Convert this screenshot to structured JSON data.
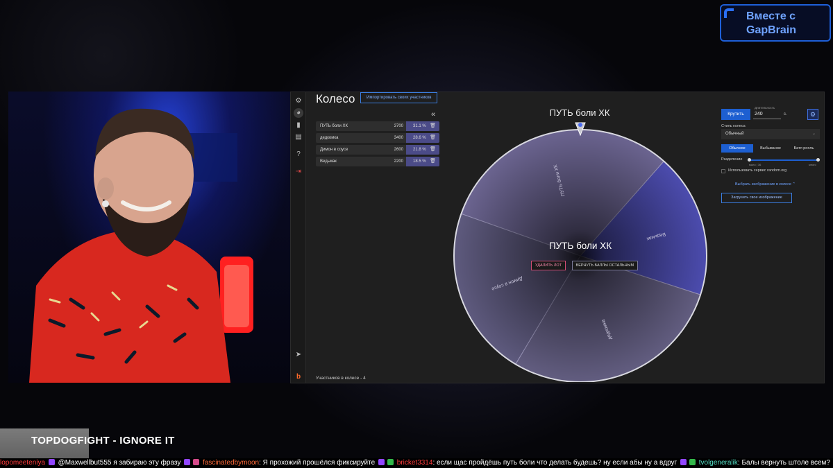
{
  "brand": {
    "line1": "Вместе с",
    "line2": "GapBrain"
  },
  "app": {
    "title": "Колесо",
    "import_button": "Импортировать своих участников",
    "collapse_glyph": "«",
    "participants": [
      {
        "name": "ПУТЬ боли ХК",
        "amount": "3700",
        "percent": "31.1 %"
      },
      {
        "name": "дедкомка",
        "amount": "3400",
        "percent": "28.6 %"
      },
      {
        "name": "Димон в соусе",
        "amount": "2600",
        "percent": "21.8 %"
      },
      {
        "name": "Ведьмак",
        "amount": "2200",
        "percent": "18.5 %"
      }
    ],
    "count_label": "Участников в колесе - 4",
    "wheel": {
      "top_label": "ПУТЬ боли ХК",
      "center_label": "ПУТЬ боли ХК",
      "delete_button": "УДАЛИТЬ ЛОТ",
      "return_button": "ВЕРНУТЬ БАЛЛЫ ОСТАЛЬНЫМ",
      "segments": [
        {
          "label": "ПУТЬ боли ХК",
          "value": 3700,
          "color": "#6b6490"
        },
        {
          "label": "Ведьмак",
          "value": 2200,
          "color": "#4c4cae"
        },
        {
          "label": "дедкомка",
          "value": 3400,
          "color": "#625d80"
        },
        {
          "label": "Димон в соусе",
          "value": 2600,
          "color": "#5e5a7e"
        }
      ]
    },
    "controls": {
      "spin_button": "Крутить",
      "duration_label": "Длительность",
      "duration_value": "240",
      "duration_unit": "с.",
      "style_label": "Стиль колеса",
      "style_value": "Обычный",
      "modes": [
        "Обычное",
        "Выбывание",
        "Батл рояль"
      ],
      "division_label": "Разделение",
      "division_min": "мало | 36",
      "division_max": "много",
      "random_org_label": "Использовать сервис random.org",
      "image_link": "Выбрать изображение в колесе  ⌃",
      "upload_button": "Загрузить свое изображение"
    }
  },
  "overlay_label": "TOPDOGFIGHT - IGNORE IT",
  "ticker": {
    "lead": "lopomeeteniya",
    "m1_user": "@Maxwellbut555",
    "m1_text": " я забираю эту фразу ",
    "m2_user": "fascinatedbymoon",
    "m2_text": ": Я прохожий прошёлся фиксируйте ",
    "m3_user": "bricket3314",
    "m3_text": ": если щас пройдёшь путь боли что делать будешь? ну если абы ну а вдруг ",
    "m4_user": "tvolgeneralik",
    "m4_text": ": Балы вернуть штоле всем?"
  },
  "colors": {
    "accent": "#1d5fd1",
    "app_bg": "#1f1f1f",
    "wheel_highlight": "#4c4cae"
  },
  "icons": [
    "gear-icon",
    "wheel-icon",
    "stats-icon",
    "list-icon",
    "help-icon",
    "logout-icon",
    "telegram-icon",
    "brand-b-icon",
    "trash-icon",
    "settings-icon"
  ]
}
